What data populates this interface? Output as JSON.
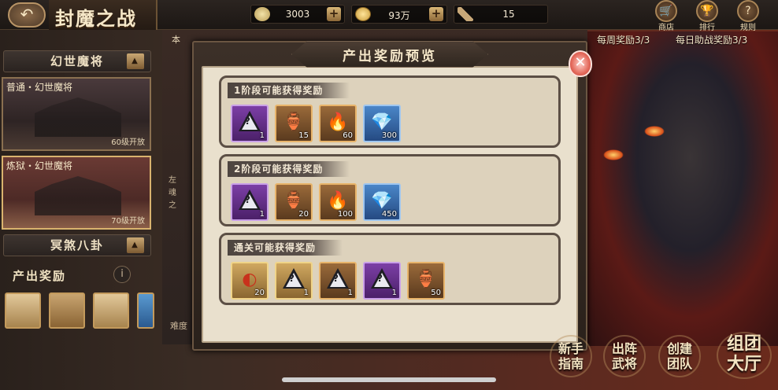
{
  "header": {
    "title": "封魔之战",
    "back_icon": "back-arrow-icon",
    "resources": [
      {
        "name": "ingot",
        "value": "3003",
        "icon": "ingot-icon"
      },
      {
        "name": "coin",
        "value": "93万",
        "icon": "coin-icon"
      },
      {
        "name": "feather",
        "value": "15",
        "icon": "feather-icon"
      }
    ],
    "buttons": [
      {
        "label": "商店",
        "icon": "shop-cart-icon"
      },
      {
        "label": "排行",
        "icon": "trophy-icon"
      },
      {
        "label": "规则",
        "icon": "question-icon"
      }
    ]
  },
  "status": {
    "weekly_reward": "每周奖励3/3",
    "daily_assist": "每日助战奖励3/3"
  },
  "left_panel": {
    "group1_title": "幻世魔将",
    "cards": [
      {
        "name": "普通・幻世魔将",
        "unlock": "60级开放"
      },
      {
        "name": "炼狱・幻世魔将",
        "unlock": "70级开放"
      }
    ],
    "group2_title": "冥煞八卦",
    "rewards_label": "产出奖励"
  },
  "center": {
    "side_tag": "本",
    "side_text": [
      "左",
      "魂",
      "之"
    ],
    "difficulty_label": "难度"
  },
  "modal": {
    "title": "产出奖励预览",
    "stages": [
      {
        "header": "1阶段可能获得奖励",
        "items": [
          {
            "type": "mystery-shard",
            "rarity": "purple",
            "count": "1"
          },
          {
            "type": "potion-jar",
            "rarity": "orange",
            "count": "15"
          },
          {
            "type": "fire-crystal",
            "rarity": "orange",
            "count": "60"
          },
          {
            "type": "blue-crystal",
            "rarity": "blue",
            "count": "300"
          }
        ]
      },
      {
        "header": "2阶段可能获得奖励",
        "items": [
          {
            "type": "mystery-shard",
            "rarity": "purple",
            "count": "1"
          },
          {
            "type": "potion-jar",
            "rarity": "orange",
            "count": "20"
          },
          {
            "type": "fire-crystal",
            "rarity": "orange",
            "count": "100"
          },
          {
            "type": "blue-crystal",
            "rarity": "blue",
            "count": "450"
          }
        ]
      },
      {
        "header": "通关可能获得奖励",
        "items": [
          {
            "type": "red-fan",
            "rarity": "gold",
            "count": "20"
          },
          {
            "type": "mystery-shard",
            "rarity": "gold",
            "count": "1"
          },
          {
            "type": "mystery-shard",
            "rarity": "orange",
            "count": "1"
          },
          {
            "type": "mystery-shard",
            "rarity": "purple",
            "count": "1"
          },
          {
            "type": "potion-jar",
            "rarity": "orange",
            "count": "50"
          }
        ]
      }
    ]
  },
  "bottom_buttons": [
    {
      "line1": "新手",
      "line2": "指南"
    },
    {
      "line1": "出阵",
      "line2": "武将"
    },
    {
      "line1": "创建",
      "line2": "团队"
    },
    {
      "line1": "组团",
      "line2": "大厅"
    }
  ],
  "colors": {
    "accent_gold": "#d9b36e",
    "modal_paper": "#e9e0cd",
    "close_red": "#e46a5c"
  }
}
